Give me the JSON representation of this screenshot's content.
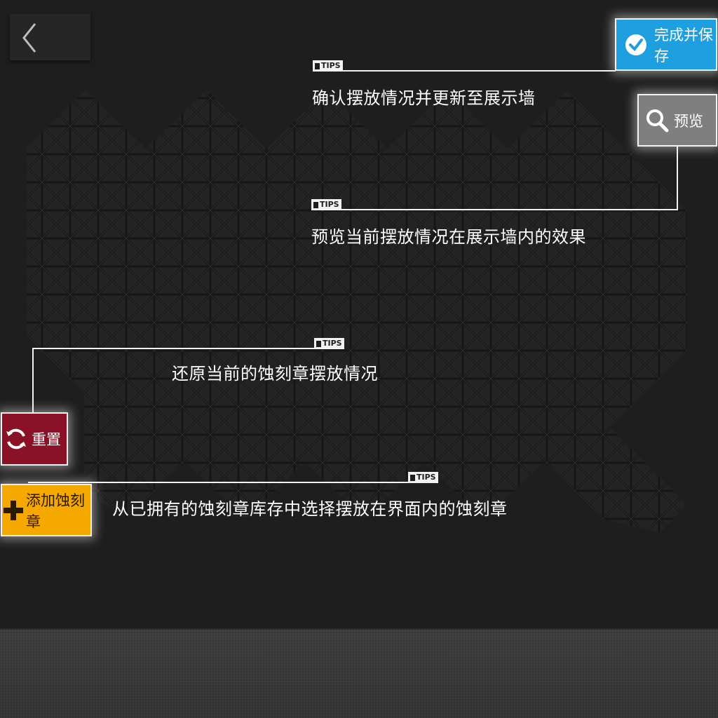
{
  "buttons": {
    "save_label": "完成并保存",
    "preview_label": "预览",
    "reset_label": "重置",
    "add_label": "添加蚀刻章"
  },
  "tips": {
    "tag_label": "TIPS",
    "save_tip": "确认摆放情况并更新至展示墙",
    "preview_tip": "预览当前摆放情况在展示墙内的效果",
    "reset_tip": "还原当前的蚀刻章摆放情况",
    "add_tip": "从已拥有的蚀刻章库存中选择摆放在界面内的蚀刻章"
  },
  "colors": {
    "save": "#1e9fe0",
    "preview": "#7f7f7f",
    "reset": "#8a1126",
    "add": "#f5a800",
    "background": "#1e1e1e"
  },
  "icons": {
    "back": "chevron-left-icon",
    "save": "check-circle-icon",
    "preview": "magnifier-icon",
    "reset": "refresh-icon",
    "add": "plus-icon"
  }
}
